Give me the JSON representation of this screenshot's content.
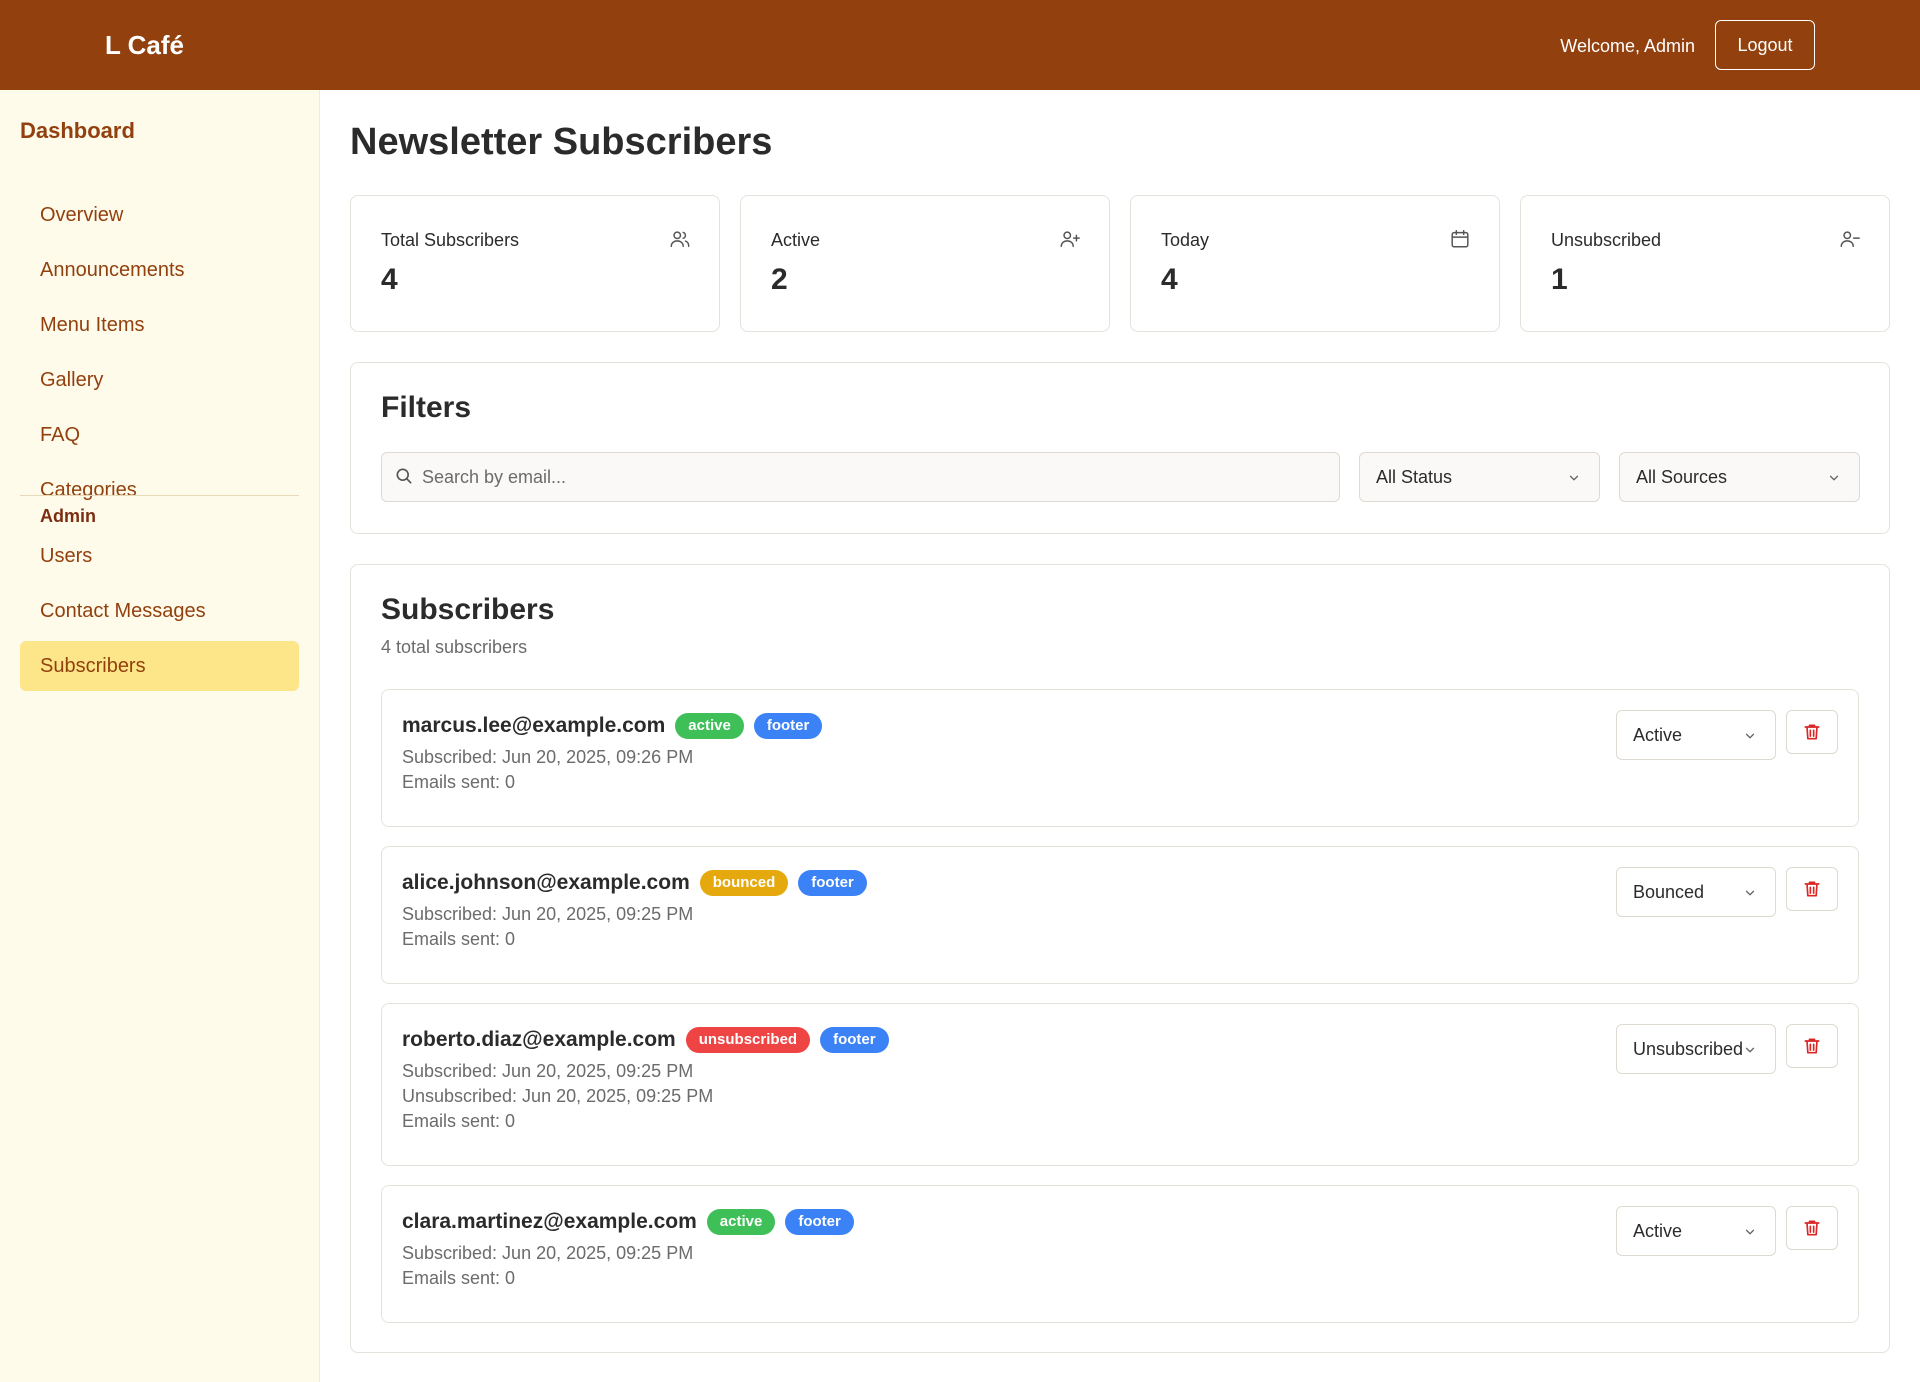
{
  "header": {
    "brand": "L Café",
    "welcome": "Welcome, Admin",
    "logout_label": "Logout",
    "color": "#92400e"
  },
  "sidebar": {
    "title": "Dashboard",
    "items": [
      {
        "label": "Overview"
      },
      {
        "label": "Announcements"
      },
      {
        "label": "Menu Items"
      },
      {
        "label": "Gallery"
      },
      {
        "label": "FAQ"
      },
      {
        "label": "Categories"
      }
    ],
    "admin_section": "Admin",
    "admin_items": [
      {
        "label": "Users"
      },
      {
        "label": "Contact Messages"
      },
      {
        "label": "Subscribers",
        "active": true
      }
    ]
  },
  "page": {
    "title": "Newsletter Subscribers"
  },
  "stats": [
    {
      "label": "Total Subscribers",
      "value": "4",
      "icon": "users-icon"
    },
    {
      "label": "Active",
      "value": "2",
      "icon": "user-plus-icon"
    },
    {
      "label": "Today",
      "value": "4",
      "icon": "calendar-icon"
    },
    {
      "label": "Unsubscribed",
      "value": "1",
      "icon": "user-minus-icon"
    }
  ],
  "filters": {
    "title": "Filters",
    "search_placeholder": "Search by email...",
    "status_value": "All Status",
    "source_value": "All Sources"
  },
  "subscribers": {
    "title": "Subscribers",
    "subtitle": "4 total subscribers",
    "rows": [
      {
        "email": "marcus.lee@example.com",
        "status_badge": "active",
        "source_badge": "footer",
        "subscribed": "Subscribed: Jun 20, 2025, 09:26 PM",
        "unsubscribed": "",
        "emails_sent": "Emails sent: 0",
        "select_value": "Active"
      },
      {
        "email": "alice.johnson@example.com",
        "status_badge": "bounced",
        "source_badge": "footer",
        "subscribed": "Subscribed: Jun 20, 2025, 09:25 PM",
        "unsubscribed": "",
        "emails_sent": "Emails sent: 0",
        "select_value": "Bounced"
      },
      {
        "email": "roberto.diaz@example.com",
        "status_badge": "unsubscribed",
        "source_badge": "footer",
        "subscribed": "Subscribed: Jun 20, 2025, 09:25 PM",
        "unsubscribed": "Unsubscribed: Jun 20, 2025, 09:25 PM",
        "emails_sent": "Emails sent: 0",
        "select_value": "Unsubscribed"
      },
      {
        "email": "clara.martinez@example.com",
        "status_badge": "active",
        "source_badge": "footer",
        "subscribed": "Subscribed: Jun 20, 2025, 09:25 PM",
        "unsubscribed": "",
        "emails_sent": "Emails sent: 0",
        "select_value": "Active"
      }
    ]
  },
  "colors": {
    "active": "#3fbf57",
    "bounced": "#e5a90e",
    "unsubscribed": "#ef4444",
    "source": "#3b82f6",
    "delete": "#dc2626"
  }
}
